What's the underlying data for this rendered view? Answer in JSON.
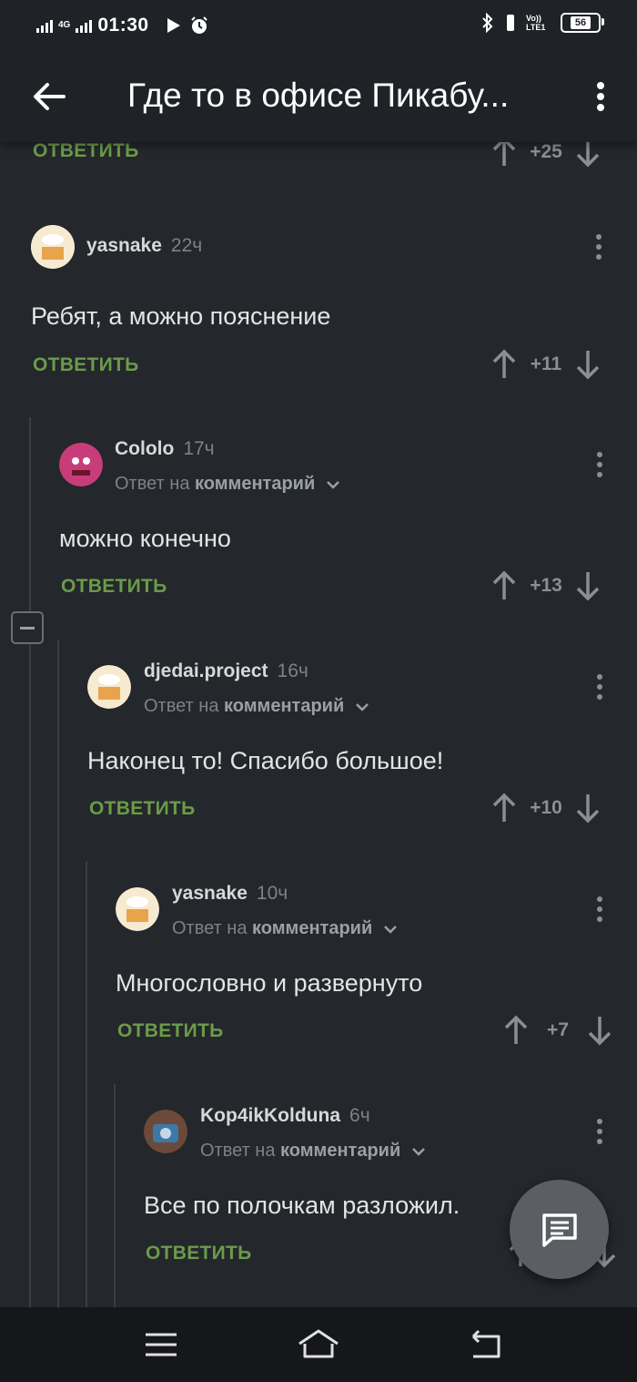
{
  "status_bar": {
    "network": "4G",
    "time": "01:30",
    "volte": "Vo)) LTE1",
    "battery": "56"
  },
  "header": {
    "title": "Где то в офисе Пикабу..."
  },
  "prev_comment": {
    "reply_label": "ОТВЕТИТЬ",
    "score": "+25"
  },
  "comments": [
    {
      "author": "yasnake",
      "time": "22ч",
      "reply_to_prefix": "",
      "reply_to_link": "",
      "text": "Ребят, а можно пояснение",
      "reply_label": "ОТВЕТИТЬ",
      "score": "+11"
    },
    {
      "author": "Cololo",
      "time": "17ч",
      "reply_to_prefix": "Ответ на",
      "reply_to_link": "комментарий",
      "text": "можно конечно",
      "reply_label": "ОТВЕТИТЬ",
      "score": "+13"
    },
    {
      "author": "djedai.project",
      "time": "16ч",
      "reply_to_prefix": "Ответ на",
      "reply_to_link": "комментарий",
      "text": "Наконец то! Спасибо большое!",
      "reply_label": "ОТВЕТИТЬ",
      "score": "+10"
    },
    {
      "author": "yasnake",
      "time": "10ч",
      "reply_to_prefix": "Ответ на",
      "reply_to_link": "комментарий",
      "text": "Многословно и развернуто",
      "reply_label": "ОТВЕТИТЬ",
      "score": "+7"
    },
    {
      "author": "Kop4ikKolduna",
      "time": "6ч",
      "reply_to_prefix": "Ответ на",
      "reply_to_link": "комментарий",
      "text": "Все по полочкам разложил.",
      "reply_label": "ОТВЕТИТЬ",
      "score": ""
    }
  ],
  "icons": {
    "back": "arrow-left-icon",
    "menu": "more-vert-icon",
    "upvote": "arrow-up-icon",
    "downvote": "arrow-down-icon",
    "fab": "comment-icon",
    "nav": [
      "menu-icon",
      "home-icon",
      "back-icon"
    ]
  },
  "colors": {
    "background": "#24272b",
    "header": "#1f2226",
    "reply_green": "#6b9b4a",
    "muted": "#7d8288"
  }
}
